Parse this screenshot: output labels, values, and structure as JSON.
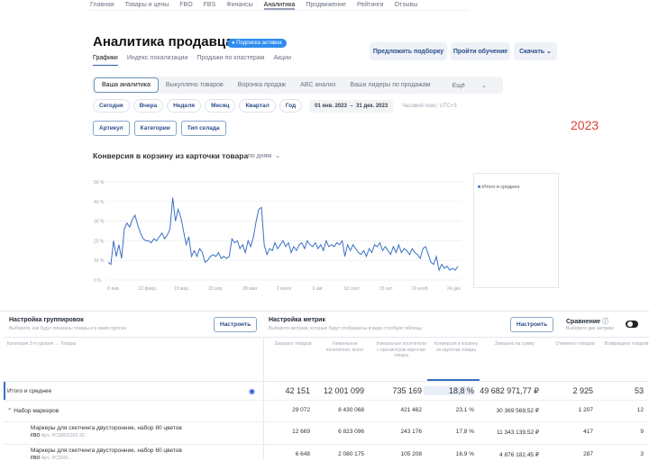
{
  "nav": [
    "Главная",
    "Товары и цены",
    "FBO",
    "FBS",
    "Финансы",
    "Аналитика",
    "Продвижение",
    "Рейтинги",
    "Отзывы"
  ],
  "nav_active": 5,
  "title": "Аналитика продавца",
  "badge": "Подписка активна",
  "subtabs": [
    "Графики",
    "Индекс локализации",
    "Продажи по кластерам",
    "Акции"
  ],
  "actions": {
    "suggest": "Предложить подборку",
    "learn": "Пройти обучение",
    "download": "Скачать"
  },
  "segments": [
    "Ваша аналитика",
    "Выкуплено товаров",
    "Воронка продаж",
    "ABC анализ",
    "Ваши лидеры по продажам",
    "Ещё"
  ],
  "periods": [
    "Сегодня",
    "Вчера",
    "Неделя",
    "Месяц",
    "Квартал",
    "Год"
  ],
  "date_from": "01 янв. 2023",
  "date_sep": "–",
  "date_to": "31 дек. 2023",
  "timezone": "Часовой пояс: UTC+3",
  "filters": [
    "Артикул",
    "Категории",
    "Тип склада"
  ],
  "year_note": "2023",
  "chart_data": {
    "type": "line",
    "title": "Конверсия в корзину из карточки товара",
    "granularity": "по дням",
    "ylim": [
      0,
      50
    ],
    "yticks": [
      "0 %",
      "10 %",
      "20 %",
      "30 %",
      "40 %",
      "50 %"
    ],
    "xticks": [
      "8 янв.",
      "12 февр.",
      "19 мар.",
      "23 апр.",
      "28 мая",
      "2 июля",
      "6 авг.",
      "10 сент.",
      "15 окт.",
      "19 нояб.",
      "24 дек."
    ],
    "legend": "Итого и среднее",
    "legend_color": "#3b6fc4",
    "series": [
      {
        "name": "Итого и среднее",
        "values": [
          9,
          8,
          20,
          12,
          18,
          11,
          26,
          29,
          27,
          31,
          33,
          28,
          24,
          21,
          20,
          20,
          19,
          21,
          20,
          22,
          24,
          21,
          23,
          26,
          42,
          30,
          36,
          32,
          25,
          18,
          22,
          12,
          15,
          12,
          16,
          14,
          9,
          10,
          12,
          13,
          12,
          14,
          11,
          12,
          11,
          12,
          21,
          19,
          20,
          16,
          18,
          14,
          20,
          17,
          22,
          30,
          36,
          37,
          18,
          13,
          16,
          15,
          19,
          16,
          18,
          20,
          17,
          19,
          14,
          17,
          15,
          18,
          19,
          16,
          20,
          18,
          17,
          19,
          16,
          18,
          15,
          20,
          17,
          18,
          17,
          19,
          18,
          20,
          12,
          18,
          15,
          18,
          16,
          14,
          13,
          15,
          12,
          16,
          14,
          18,
          17,
          19,
          15,
          17,
          15,
          13,
          17,
          14,
          18,
          14,
          16,
          15,
          13,
          16,
          14,
          13,
          11,
          16,
          17,
          13,
          9,
          8,
          12,
          5,
          8,
          6,
          7,
          5,
          6,
          5,
          7
        ]
      }
    ]
  },
  "grouping": {
    "title": "Настройка группировок",
    "hint": "Выберите, как будут показаны товары и в каких группах",
    "button": "Настроить"
  },
  "metrics": {
    "title": "Настройка метрик",
    "hint": "Выберите метрики, которые будут отображены в виде столбцов таблицы",
    "button": "Настроить"
  },
  "compare": {
    "title": "Сравнение",
    "hint": "Выберите две метрики"
  },
  "table": {
    "first_header": "Категория 3-го уровня → Товары",
    "headers": [
      "Заказано товаров",
      "Уникальные посетители, всего",
      "Уникальные посетители с просмотром карточки товара",
      "Конверсия в корзину из карточки товара",
      "Заказано на сумму",
      "Отменено товаров",
      "Возвращено товаров"
    ],
    "rows": [
      {
        "name": "Итого и среднее",
        "values": [
          "42 151",
          "12 001 099",
          "735 169",
          "18,8 %",
          "49 682 971,77 ₽",
          "2 925",
          "53"
        ]
      },
      {
        "name": "Набор маркеров",
        "values": [
          "29 072",
          "8 430 068",
          "421 462",
          "23,1 %",
          "30 369 569,52 ₽",
          "1 207",
          "12"
        ]
      },
      {
        "name": "Маркеры для скетчинга двусторонние, набор 80 цветов",
        "sub": "FBO",
        "art": "Арт.: PCS80/1202-3C",
        "values": [
          "12 669",
          "6 823 096",
          "243 176",
          "17,8 %",
          "11 343 139,52 ₽",
          "417",
          "9"
        ]
      },
      {
        "name": "Маркеры для скетчинга двусторонние, набор 60 цветов",
        "sub": "FBO",
        "art": "Арт.: PCS60/...",
        "values": [
          "6 648",
          "2 080 175",
          "105 208",
          "16,9 %",
          "4 876 182,45 ₽",
          "287",
          "3"
        ]
      }
    ]
  }
}
